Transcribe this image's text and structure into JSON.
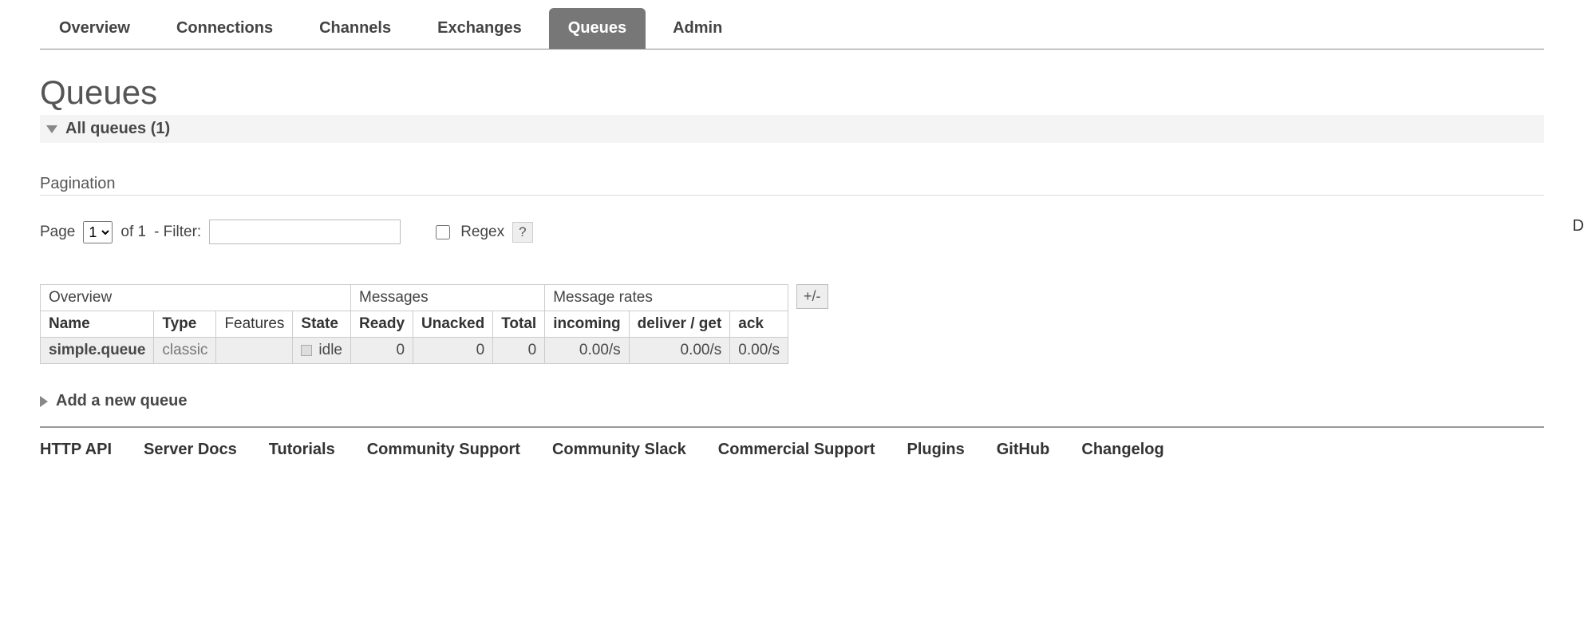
{
  "tabs": {
    "overview": "Overview",
    "connections": "Connections",
    "channels": "Channels",
    "exchanges": "Exchanges",
    "queues": "Queues",
    "admin": "Admin",
    "active": "queues"
  },
  "page_title": "Queues",
  "all_queues_label": "All queues (1)",
  "pagination_label": "Pagination",
  "pager": {
    "page_label": "Page",
    "page_value": "1",
    "of_label": "of 1",
    "filter_label": "- Filter:",
    "filter_value": "",
    "regex_label": "Regex",
    "help": "?"
  },
  "table": {
    "group_overview": "Overview",
    "group_messages": "Messages",
    "group_rates": "Message rates",
    "plusminus": "+/-",
    "cols": {
      "name": "Name",
      "type": "Type",
      "features": "Features",
      "state": "State",
      "ready": "Ready",
      "unacked": "Unacked",
      "total": "Total",
      "incoming": "incoming",
      "deliver_get": "deliver / get",
      "ack": "ack"
    },
    "row": {
      "name": "simple.queue",
      "type": "classic",
      "features": "",
      "state": "idle",
      "ready": "0",
      "unacked": "0",
      "total": "0",
      "incoming": "0.00/s",
      "deliver_get": "0.00/s",
      "ack": "0.00/s"
    }
  },
  "add_queue_label": "Add a new queue",
  "footer": {
    "http_api": "HTTP API",
    "server_docs": "Server Docs",
    "tutorials": "Tutorials",
    "community_support": "Community Support",
    "community_slack": "Community Slack",
    "commercial_support": "Commercial Support",
    "plugins": "Plugins",
    "github": "GitHub",
    "changelog": "Changelog"
  },
  "right_cut": "D"
}
